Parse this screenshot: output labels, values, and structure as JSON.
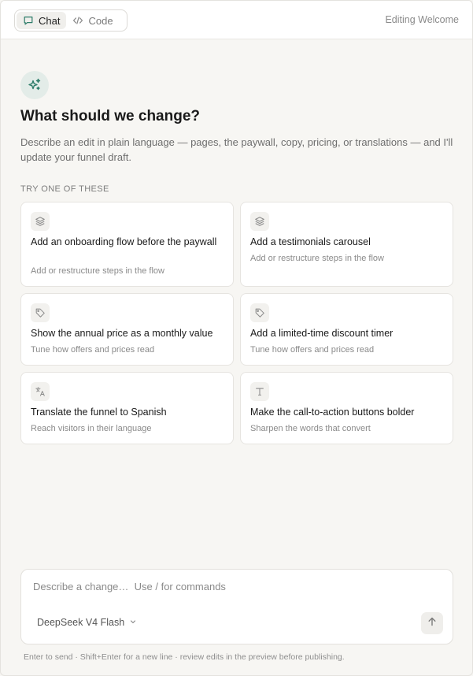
{
  "header": {
    "tabs": [
      {
        "label": "Chat",
        "icon": "chat-bubble-icon",
        "active": true
      },
      {
        "label": "Code",
        "icon": "code-icon",
        "active": false
      }
    ],
    "status": "Editing Welcome"
  },
  "hero": {
    "icon": "sparkles-icon",
    "title": "What should we change?",
    "description": "Describe an edit in plain language — pages, the paywall, copy, pricing, or translations — and I'll update your funnel draft."
  },
  "suggestions": {
    "label": "TRY ONE OF THESE",
    "items": [
      {
        "title": "Add an onboarding flow before the paywall",
        "subtitle": "Add or restructure steps in the flow",
        "icon": "layers-icon"
      },
      {
        "title": "Add a testimonials carousel",
        "subtitle": "Add or restructure steps in the flow",
        "icon": "layers-icon"
      },
      {
        "title": "Show the annual price as a monthly value",
        "subtitle": "Tune how offers and prices read",
        "icon": "tag-icon"
      },
      {
        "title": "Add a limited-time discount timer",
        "subtitle": "Tune how offers and prices read",
        "icon": "tag-icon"
      },
      {
        "title": "Translate the funnel to Spanish",
        "subtitle": "Reach visitors in their language",
        "icon": "translate-icon"
      },
      {
        "title": "Make the call-to-action buttons bolder",
        "subtitle": "Sharpen the words that convert",
        "icon": "type-icon"
      }
    ]
  },
  "composer": {
    "placeholder": "Describe a change…  Use / for commands",
    "value": "",
    "model": "DeepSeek V4 Flash"
  },
  "footer_hint": "Enter to send · Shift+Enter for a new line · review edits in the preview before publishing.",
  "colors": {
    "background": "#f7f6f3",
    "accent_soft": "#e3ece8",
    "accent_icon": "#2f7d6a"
  }
}
